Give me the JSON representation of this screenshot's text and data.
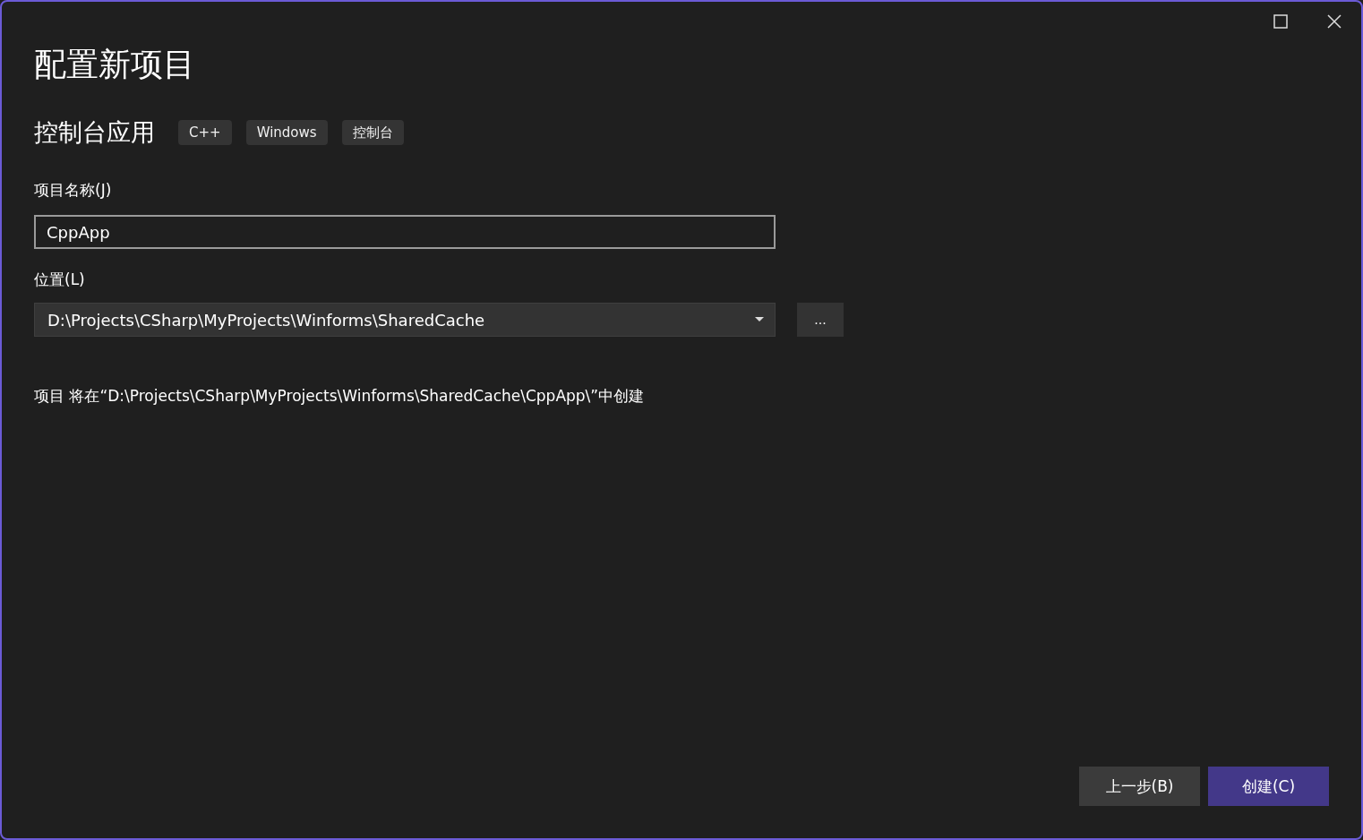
{
  "window": {
    "title": "配置新项目"
  },
  "template": {
    "name": "控制台应用",
    "tags": [
      "C++",
      "Windows",
      "控制台"
    ]
  },
  "project_name": {
    "label": "项目名称(J)",
    "value": "CppApp"
  },
  "location": {
    "label": "位置(L)",
    "value": "D:\\Projects\\CSharp\\MyProjects\\Winforms\\SharedCache",
    "browse": "..."
  },
  "info": "项目 将在“D:\\Projects\\CSharp\\MyProjects\\Winforms\\SharedCache\\CppApp\\”中创建",
  "buttons": [
    {
      "label": "上一步(B)",
      "kind": "secondary"
    },
    {
      "label": "创建(C)",
      "kind": "primary"
    }
  ]
}
